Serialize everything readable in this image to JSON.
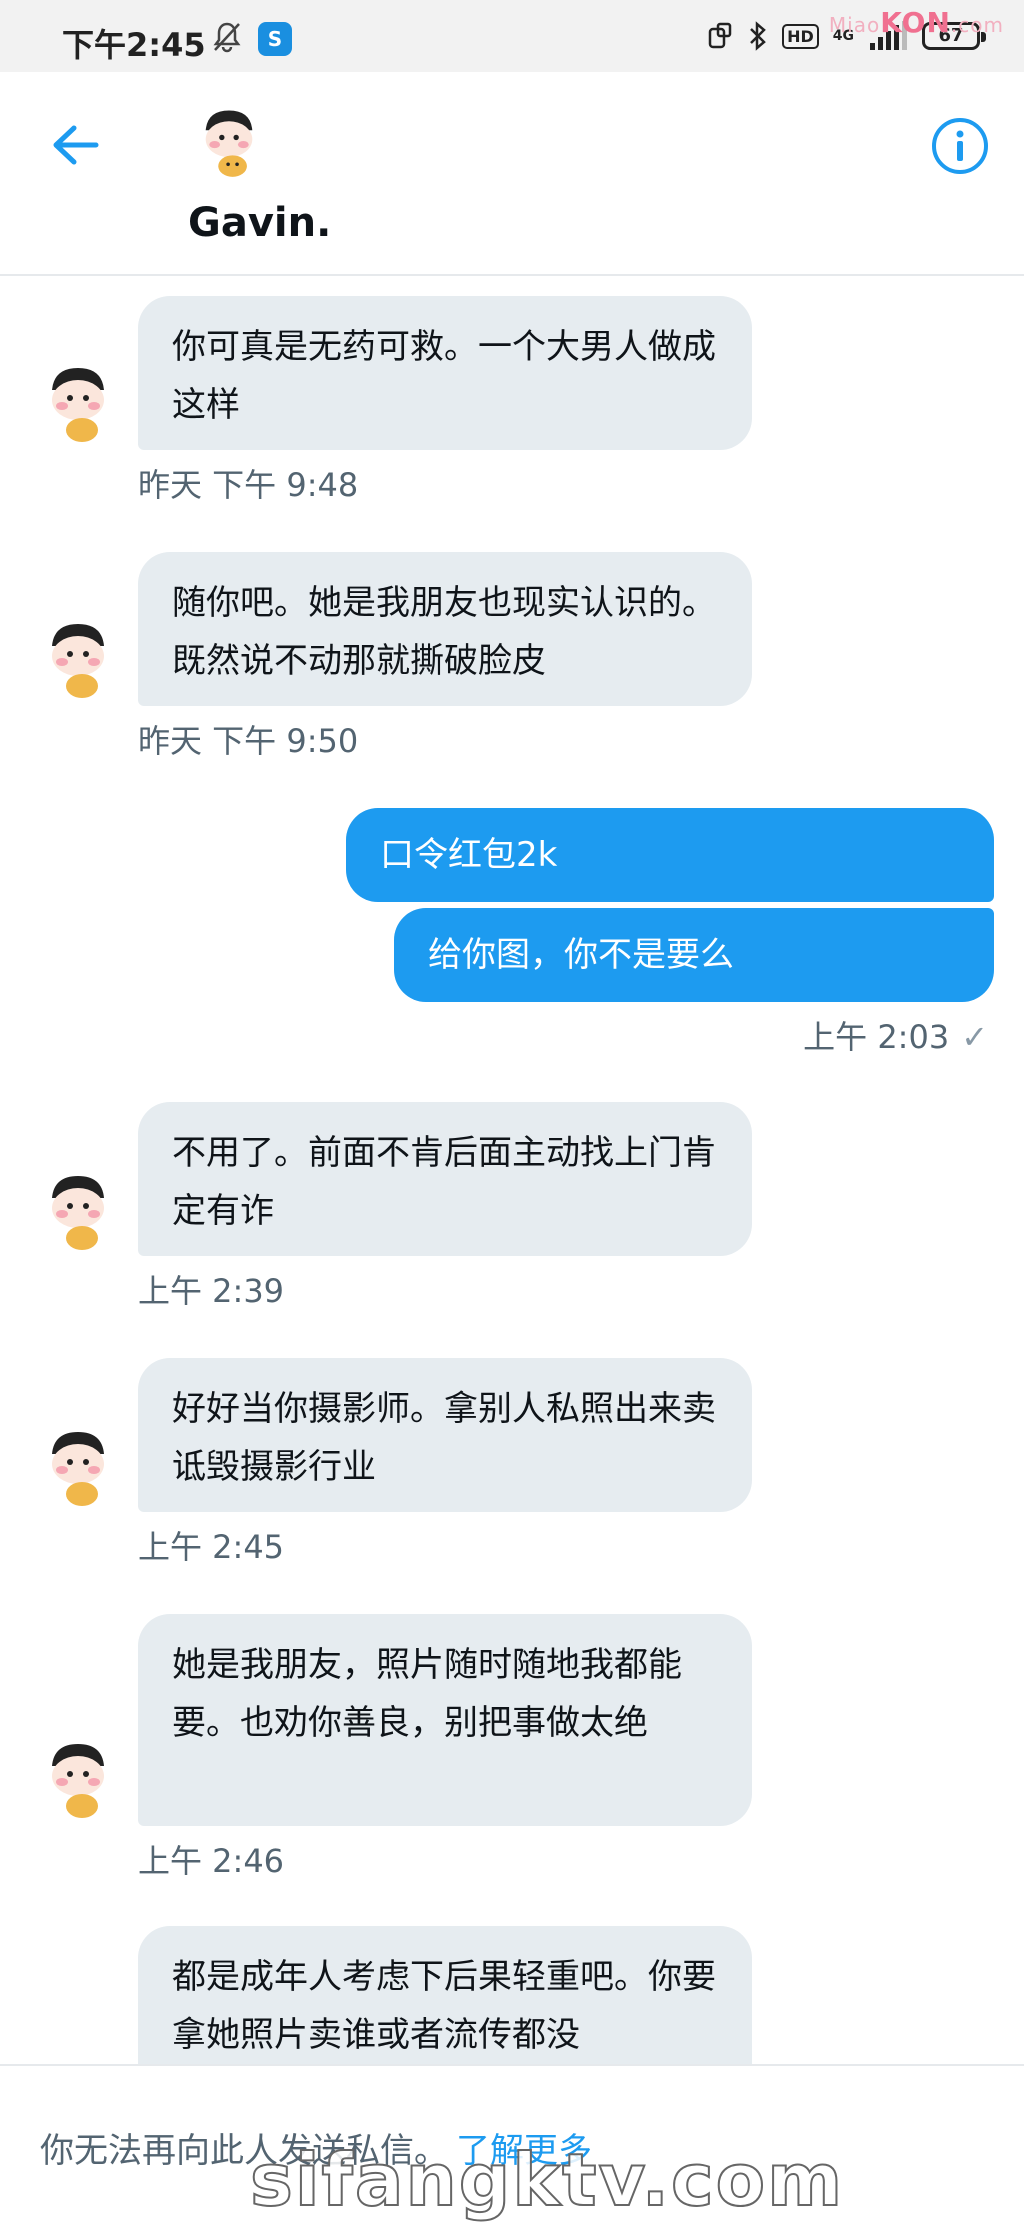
{
  "status_bar": {
    "time": "下午2:45",
    "network": "4G",
    "hd_label": "HD",
    "battery": "67",
    "watermark_prefix": "Miao",
    "watermark_brand": "KON",
    "watermark_suffix": ".com"
  },
  "header": {
    "contact_name": "Gavin."
  },
  "messages": [
    {
      "text": "你可真是无药可救。一个大男人做成这样",
      "time": "昨天 下午 9:48"
    },
    {
      "text": "随你吧。她是我朋友也现实认识的。既然说不动那就撕破脸皮",
      "time": "昨天 下午 9:50"
    },
    {
      "text": "口令红包2k"
    },
    {
      "text": "给你图，你不是要么",
      "time": "上午 2:03"
    },
    {
      "text": "不用了。前面不肯后面主动找上门肯定有诈",
      "time": "上午 2:39"
    },
    {
      "text": "好好当你摄影师。拿别人私照出来卖诋毁摄影行业",
      "time": "上午 2:45"
    },
    {
      "text": "她是我朋友，照片随时随地我都能要。也劝你善良，别把事做太绝",
      "time": "上午 2:46"
    },
    {
      "text": "都是成年人考虑下后果轻重吧。你要拿她照片卖谁或者流传都没"
    }
  ],
  "sent_check": "✓",
  "footer": {
    "notice": "你无法再向此人发送私信。",
    "link": "了解更多"
  },
  "site_watermark": "sifangktv.com",
  "colors": {
    "accent": "#1d9bf0",
    "incoming_bubble": "#e6ecf0",
    "timestamp": "#536471"
  },
  "icons": {
    "back": "arrow-left-icon",
    "info": "info-circle-icon",
    "bell": "bell-off-icon",
    "bluetooth": "bluetooth-icon",
    "signal": "signal-bars-icon",
    "battery": "battery-icon",
    "avatar": "cartoon-avatar"
  }
}
